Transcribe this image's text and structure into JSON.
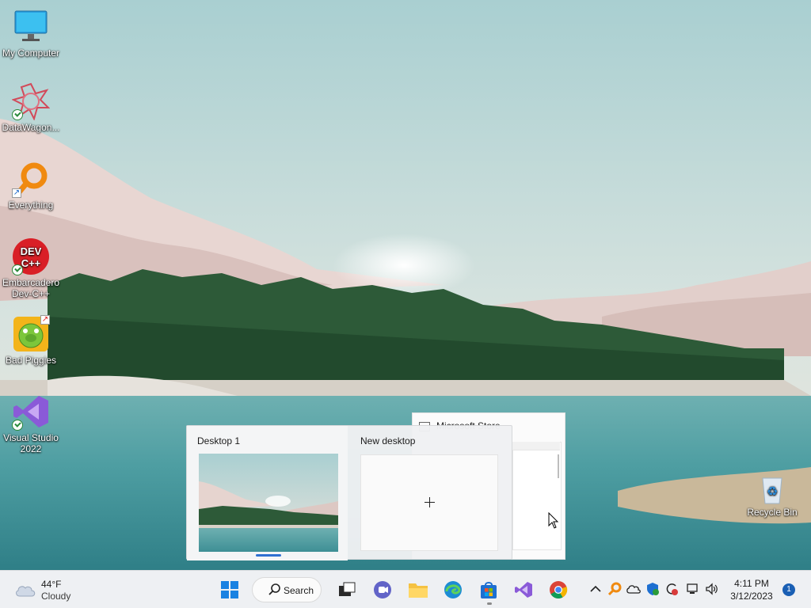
{
  "desktop": {
    "icons": [
      {
        "label": "My Computer"
      },
      {
        "label": "DataWagon..."
      },
      {
        "label": "Everything"
      },
      {
        "label": "Embarcadero Dev-C++"
      },
      {
        "label": "Bad Piggies"
      },
      {
        "label": "Visual Studio 2022"
      },
      {
        "label": "Recycle Bin"
      }
    ]
  },
  "background_window": {
    "title": "Microsoft Store"
  },
  "task_view": {
    "desktops": [
      {
        "label": "Desktop 1",
        "active": true
      },
      {
        "label": "New desktop"
      }
    ]
  },
  "taskbar": {
    "weather": {
      "temp": "44°F",
      "condition": "Cloudy",
      "icon": "cloud-icon"
    },
    "search_label": "Search",
    "pinned": [
      {
        "name": "start",
        "icon": "windows-logo-icon"
      },
      {
        "name": "task-view",
        "icon": "task-view-icon"
      },
      {
        "name": "chat",
        "icon": "teams-chat-icon"
      },
      {
        "name": "file-explorer",
        "icon": "folder-icon"
      },
      {
        "name": "edge",
        "icon": "edge-icon"
      },
      {
        "name": "store",
        "icon": "store-bag-icon"
      },
      {
        "name": "visual-studio",
        "icon": "visual-studio-icon"
      },
      {
        "name": "chrome",
        "icon": "chrome-icon"
      }
    ],
    "clock": {
      "time": "4:11 PM",
      "date": "3/12/2023"
    },
    "notification_count": "1"
  },
  "colors": {
    "accent": "#2f6fd1",
    "taskbar": "#eef0f3",
    "notification": "#1a5fb4"
  }
}
